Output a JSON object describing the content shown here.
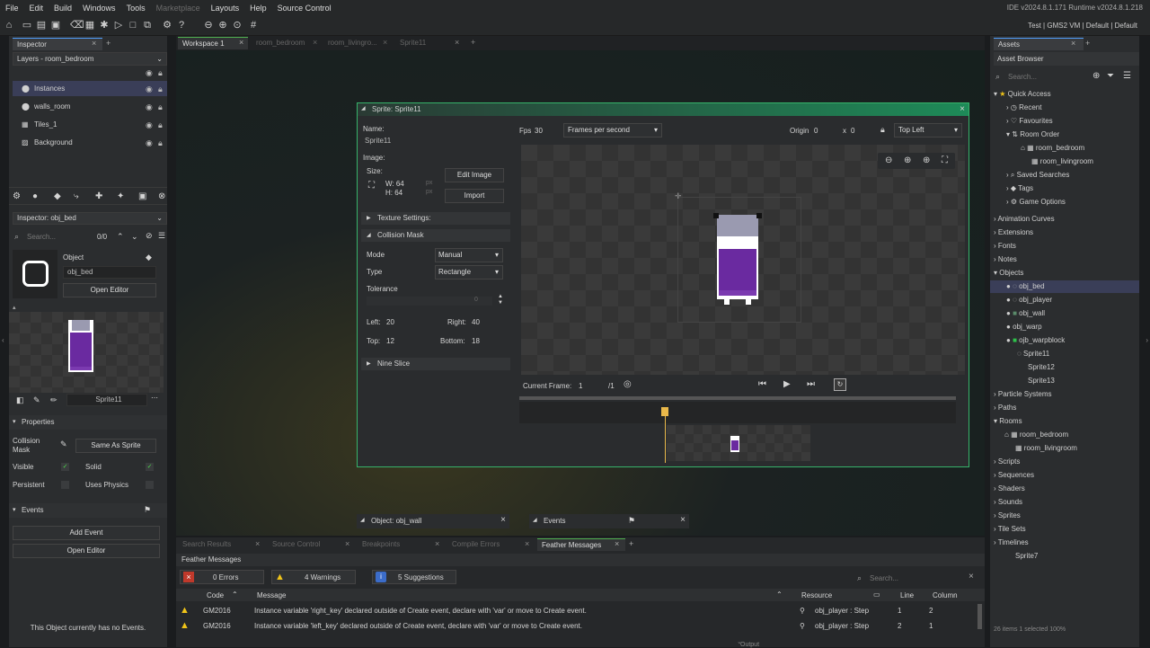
{
  "menu": [
    "File",
    "Edit",
    "Build",
    "Windows",
    "Tools",
    "Marketplace",
    "Layouts",
    "Help",
    "Source Control"
  ],
  "version": "IDE v2024.8.1.171  Runtime v2024.8.1.218",
  "targets": "Test | GMS2 VM | Default | Default",
  "left": {
    "tab": "Inspector",
    "layers_title": "Layers - room_bedroom",
    "layers": [
      "Instances",
      "walls_room",
      "Tiles_1",
      "Background"
    ],
    "inspector_title": "Inspector: obj_bed",
    "search_placeholder": "Search...",
    "search_count": "0/0",
    "object_label": "Object",
    "object_name": "obj_bed",
    "open_editor": "Open Editor",
    "sprite_name": "Sprite11",
    "properties": "Properties",
    "collision_mask": "Collision Mask",
    "same_as_sprite": "Same As Sprite",
    "visible": "Visible",
    "solid": "Solid",
    "persistent": "Persistent",
    "uses_physics": "Uses Physics",
    "events": "Events",
    "add_event": "Add Event",
    "open_editor2": "Open Editor",
    "no_events": "This Object currently has no Events."
  },
  "tabs": [
    "Workspace 1",
    "room_bedroom",
    "room_livingro...",
    "Sprite11"
  ],
  "sprite": {
    "title": "Sprite: Sprite11",
    "name_label": "Name:",
    "name": "Sprite11",
    "image_label": "Image:",
    "size_label": "Size:",
    "w": "W: 64",
    "h": "H: 64",
    "px": "px",
    "edit_image": "Edit Image",
    "import": "Import",
    "texture_settings": "Texture Settings:",
    "collision_mask": "Collision Mask",
    "mode_label": "Mode",
    "mode": "Manual",
    "type_label": "Type",
    "type": "Rectangle",
    "tolerance": "Tolerance",
    "tolerance_val": "0",
    "left_label": "Left:",
    "left": "20",
    "right_label": "Right:",
    "right": "40",
    "top_label": "Top:",
    "top": "12",
    "bottom_label": "Bottom:",
    "bottom": "18",
    "nine_slice": "Nine Slice",
    "fps_label": "Fps",
    "fps": "30",
    "fps_mode": "Frames per second",
    "origin_label": "Origin",
    "origin_x": "0",
    "x_label": "x",
    "origin_y": "0",
    "origin_mode": "Top Left",
    "current_frame_label": "Current Frame:",
    "current_frame": "1",
    "frames_total": "/1"
  },
  "floating": {
    "obj_wall": "Object: obj_wall",
    "events": "Events"
  },
  "bottom": {
    "tabs": [
      "Search Results",
      "Source Control",
      "Breakpoints",
      "Compile Errors",
      "Feather Messages"
    ],
    "title": "Feather Messages",
    "errors": "0 Errors",
    "warnings": "4 Warnings",
    "suggestions": "5 Suggestions",
    "search_placeholder": "Search...",
    "cols": [
      "Code",
      "Message",
      "Resource",
      "Line",
      "Column"
    ],
    "rows": [
      {
        "code": "GM2016",
        "msg": "Instance variable 'right_key' declared outside of Create event, declare with 'var' or move to Create event.",
        "res": "obj_player : Step",
        "line": "1",
        "col": "2"
      },
      {
        "code": "GM2016",
        "msg": "Instance variable 'left_key' declared outside of Create event, declare with 'var' or move to Create event.",
        "res": "obj_player : Step",
        "line": "2",
        "col": "1"
      }
    ]
  },
  "right": {
    "tab": "Assets",
    "title": "Asset Browser",
    "search_placeholder": "Search...",
    "tree": [
      "Quick Access",
      "Recent",
      "Favourites",
      "Room Order",
      "room_bedroom",
      "room_livingroom",
      "Saved Searches",
      "Tags",
      "Game Options",
      "Animation Curves",
      "Extensions",
      "Fonts",
      "Notes",
      "Objects",
      "obj_bed",
      "obj_player",
      "obj_wall",
      "obj_warp",
      "ojb_warpblock",
      "Sprite11",
      "Sprite12",
      "Sprite13",
      "Particle Systems",
      "Paths",
      "Rooms",
      "room_bedroom",
      "room_livingroom",
      "Scripts",
      "Sequences",
      "Shaders",
      "Sounds",
      "Sprites",
      "Tile Sets",
      "Timelines",
      "Sprite7"
    ],
    "footer": "26 items    1 selected  100%"
  },
  "output": "Output"
}
